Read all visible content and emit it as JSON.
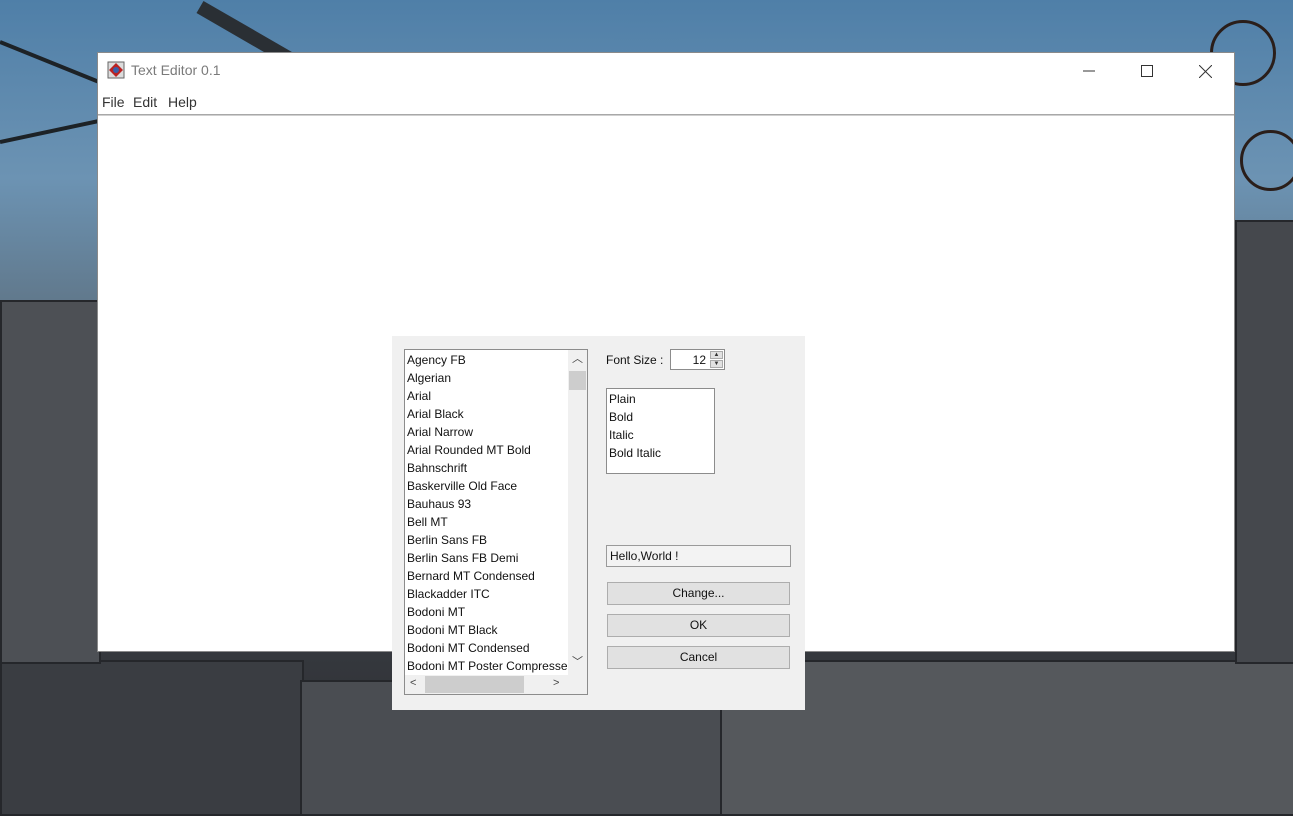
{
  "window": {
    "title": "Text Editor 0.1",
    "controls": {
      "minimize": "—",
      "maximize": "☐",
      "close": "✕"
    }
  },
  "menubar": {
    "items": [
      "File",
      "Edit",
      "Help"
    ]
  },
  "dialog": {
    "fonts": [
      "Agency FB",
      "Algerian",
      "Arial",
      "Arial Black",
      "Arial Narrow",
      "Arial Rounded MT Bold",
      "Bahnschrift",
      "Baskerville Old Face",
      "Bauhaus 93",
      "Bell MT",
      "Berlin Sans FB",
      "Berlin Sans FB Demi",
      "Bernard MT Condensed",
      "Blackadder ITC",
      "Bodoni MT",
      "Bodoni MT Black",
      "Bodoni MT Condensed",
      "Bodoni MT Poster Compressed"
    ],
    "font_size_label": "Font Size :",
    "font_size_value": "12",
    "styles": [
      "Plain",
      "Bold",
      "Italic",
      "Bold Italic"
    ],
    "preview_text": "Hello,World !",
    "buttons": {
      "change": "Change...",
      "ok": "OK",
      "cancel": "Cancel"
    }
  },
  "colors": {
    "window_bg": "#ffffff",
    "dialog_bg": "#f0f0f0",
    "button_bg": "#e1e1e1"
  }
}
